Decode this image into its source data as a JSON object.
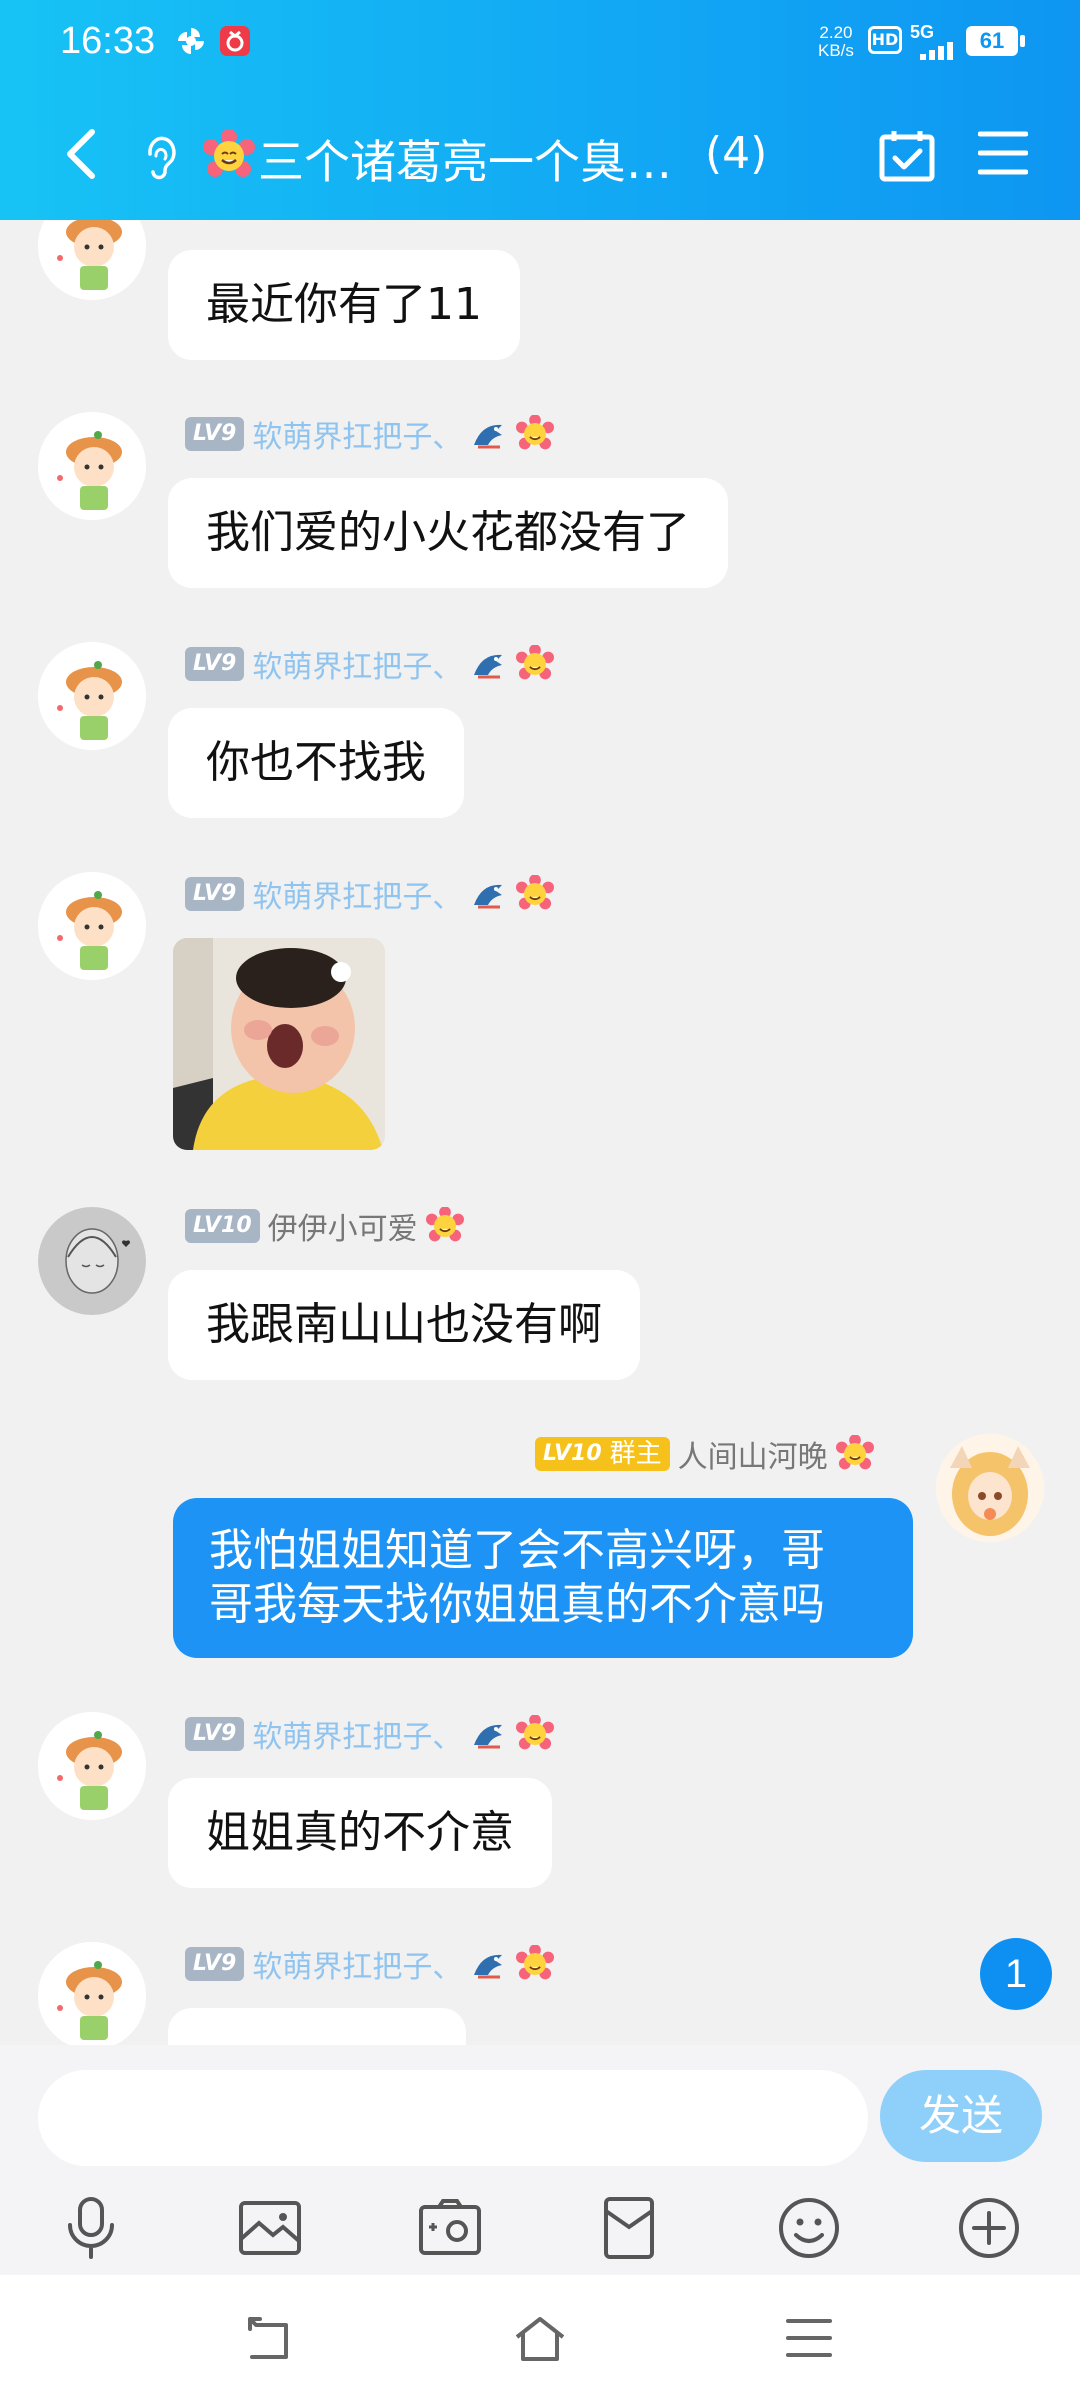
{
  "status_bar": {
    "time": "16:33",
    "net_speed_value": "2.20",
    "net_speed_unit": "KB/s",
    "hd": "HD",
    "network": "5G",
    "battery": "61"
  },
  "header": {
    "title": "三个诸葛亮一个臭…",
    "member_count": "(4)"
  },
  "messages": [
    {
      "sender": "",
      "level": "",
      "text": "最近你有了11"
    },
    {
      "sender": "软萌界扛把子、",
      "level": "LV9",
      "text": "我们爱的小火花都没有了"
    },
    {
      "sender": "软萌界扛把子、",
      "level": "LV9",
      "text": "你也不找我"
    },
    {
      "sender": "软萌界扛把子、",
      "level": "LV9",
      "text": ""
    },
    {
      "sender": "伊伊小可爱",
      "level": "LV10",
      "text": "我跟南山山也没有啊"
    },
    {
      "sender": "人间山河晚",
      "level": "LV10",
      "role": "群主",
      "text_line1": "我怕姐姐知道了会不高兴呀，哥",
      "text_line2": "哥我每天找你姐姐真的不介意吗"
    },
    {
      "sender": "软萌界扛把子、",
      "level": "LV9",
      "text": "姐姐真的不介意"
    },
    {
      "sender": "软萌界扛把子、",
      "level": "LV9",
      "text": ""
    }
  ],
  "unread_badge": "1",
  "input": {
    "placeholder": "",
    "value": "",
    "send_label": "发送"
  },
  "toolbar_icons": [
    "microphone-icon",
    "image-icon",
    "camera-icon",
    "red-packet-icon",
    "emoji-icon",
    "plus-icon"
  ],
  "nav_icons": [
    "back-nav-icon",
    "home-nav-icon",
    "menu-nav-icon"
  ],
  "colors": {
    "header_start": "#17c3f5",
    "header_end": "#0e96f2",
    "my_bubble": "#1c93f5",
    "send_button": "#8fd0fb",
    "nickname": "#8fc4f0"
  }
}
